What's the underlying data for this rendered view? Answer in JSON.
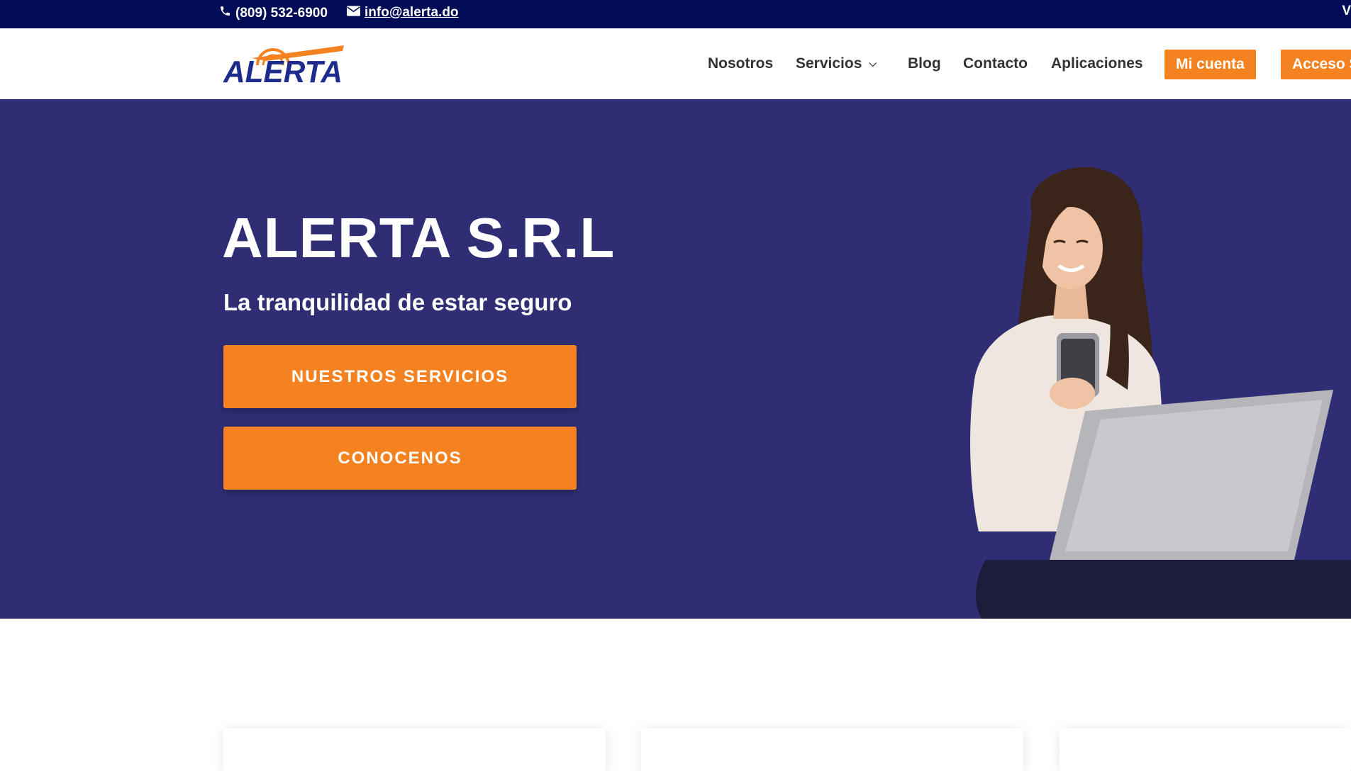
{
  "topbar": {
    "phone": "(809) 532-6900",
    "email": "info@alerta.do",
    "edge_text": "V",
    "phone_icon": "phone-icon",
    "mail_icon": "envelope-icon"
  },
  "header": {
    "logo_text": "ALERTA",
    "nav": [
      {
        "label": "Nosotros"
      },
      {
        "label": "Servicios"
      },
      {
        "label": "Blog"
      },
      {
        "label": "Contacto"
      },
      {
        "label": "Aplicaciones"
      }
    ],
    "account_button": "Mi cuenta",
    "access_button": "Acceso S"
  },
  "hero": {
    "title": "ALERTA S.R.L",
    "subtitle": "La tranquilidad de estar seguro",
    "cta_primary": "NUESTROS SERVICIOS",
    "cta_secondary": "CONOCENOS"
  },
  "colors": {
    "topbar_bg": "#020c56",
    "hero_bg": "#2f2d74",
    "accent_orange": "#f58220",
    "logo_blue": "#1d2b8c",
    "nav_text": "#333333"
  }
}
